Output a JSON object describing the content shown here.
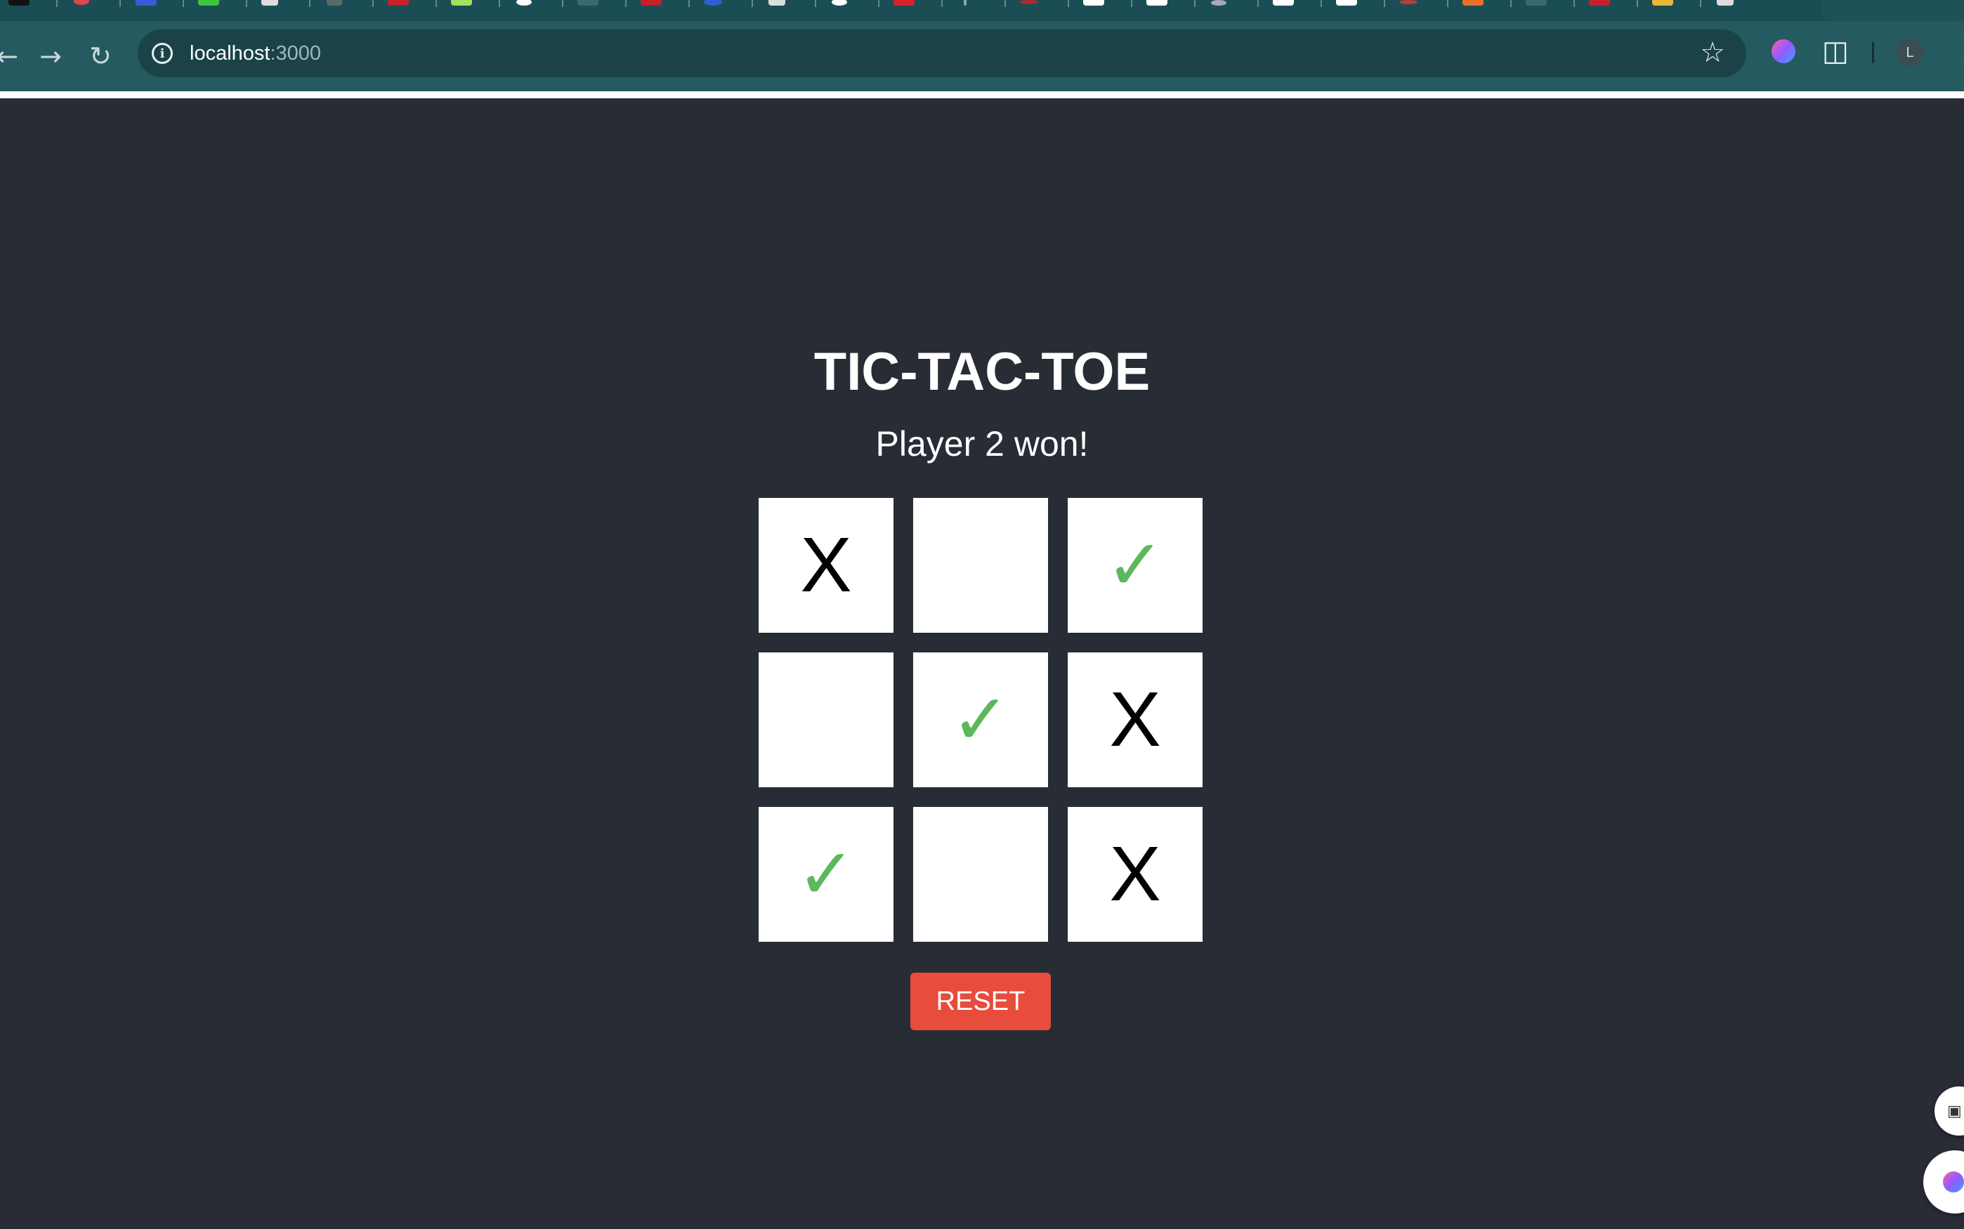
{
  "browser": {
    "url_host": "localhost",
    "url_port": ":3000",
    "avatar_initial": "L",
    "icons": {
      "back": "arrow-left-icon",
      "forward": "arrow-right-icon",
      "reload": "reload-icon",
      "info": "info-icon",
      "bookmark": "star-icon",
      "extensions": "puzzle-icon",
      "menu": "kebab-menu-icon"
    },
    "colors": {
      "tabstrip": "#1b4e54",
      "toolbar": "#245a60",
      "omnibox": "#1a4247"
    }
  },
  "game": {
    "title": "TIC-TAC-TOE",
    "status": "Player 2 won!",
    "board": [
      [
        "X",
        "",
        "✓"
      ],
      [
        "",
        "✓",
        "X"
      ],
      [
        "✓",
        "",
        "X"
      ]
    ],
    "player1_mark": "X",
    "player2_mark": "✓",
    "reset_label": "RESET",
    "colors": {
      "background": "#282c34",
      "cell": "#ffffff",
      "check": "#5cb85c",
      "reset": "#e74c3c"
    }
  }
}
